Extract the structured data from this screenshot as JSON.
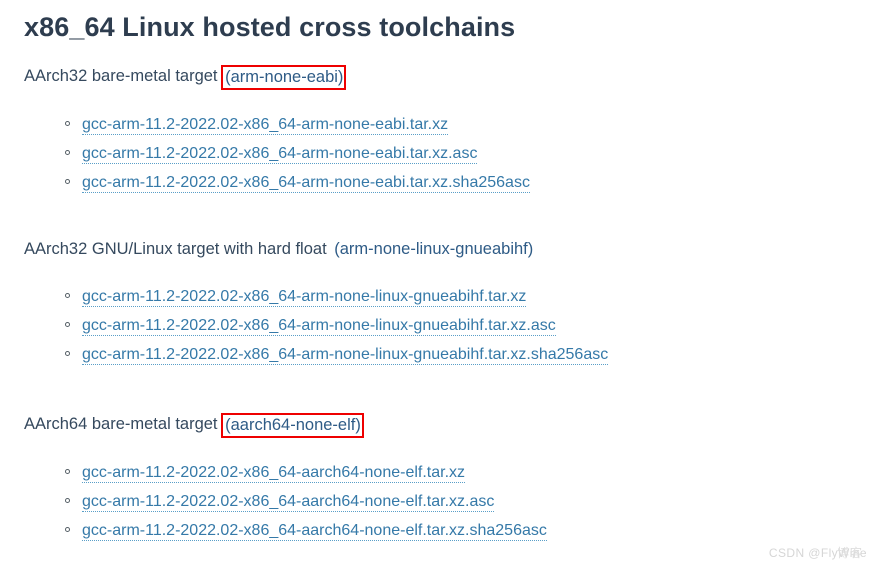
{
  "page": {
    "title": "x86_64 Linux hosted cross toolchains",
    "background_color": "#ffffff",
    "link_color": "#3579a8",
    "heading_color": "#35495e",
    "highlight_box_color": "#ee0000"
  },
  "sections": [
    {
      "heading_prefix": "AArch32 bare-metal target ",
      "heading_target": "(arm-none-eabi)",
      "target_highlighted": true,
      "links": [
        "gcc-arm-11.2-2022.02-x86_64-arm-none-eabi.tar.xz",
        "gcc-arm-11.2-2022.02-x86_64-arm-none-eabi.tar.xz.asc",
        "gcc-arm-11.2-2022.02-x86_64-arm-none-eabi.tar.xz.sha256asc"
      ]
    },
    {
      "heading_prefix": "AArch32 GNU/Linux target with hard float ",
      "heading_target": "(arm-none-linux-gnueabihf)",
      "target_highlighted": false,
      "links": [
        "gcc-arm-11.2-2022.02-x86_64-arm-none-linux-gnueabihf.tar.xz",
        "gcc-arm-11.2-2022.02-x86_64-arm-none-linux-gnueabihf.tar.xz.asc",
        "gcc-arm-11.2-2022.02-x86_64-arm-none-linux-gnueabihf.tar.xz.sha256asc"
      ]
    },
    {
      "heading_prefix": "AArch64 bare-metal target ",
      "heading_target": "(aarch64-none-elf)",
      "target_highlighted": true,
      "links": [
        "gcc-arm-11.2-2022.02-x86_64-aarch64-none-elf.tar.xz",
        "gcc-arm-11.2-2022.02-x86_64-aarch64-none-elf.tar.xz.asc",
        "gcc-arm-11.2-2022.02-x86_64-aarch64-none-elf.tar.xz.sha256asc"
      ]
    }
  ],
  "watermark": {
    "text": "CSDN @FlyWine",
    "overlay_text": "博客"
  }
}
